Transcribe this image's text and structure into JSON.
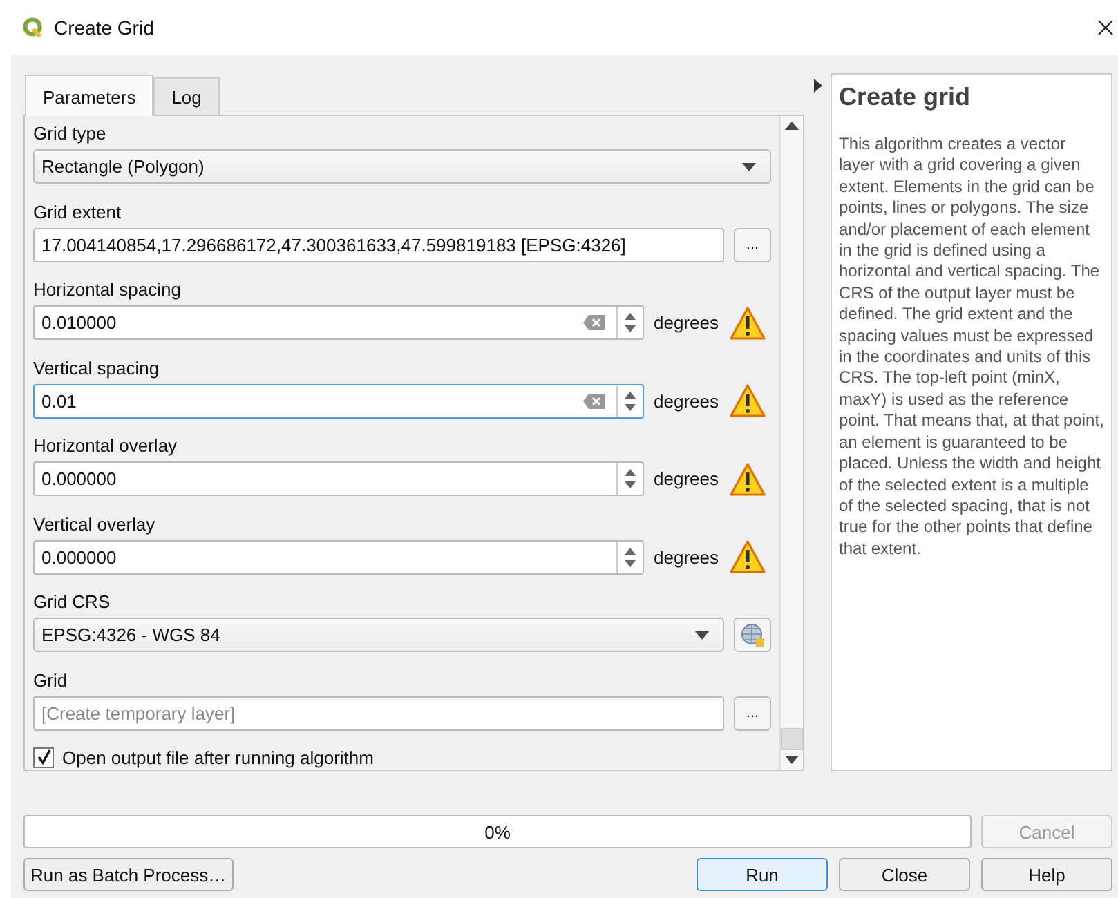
{
  "window": {
    "title": "Create Grid"
  },
  "tabs": [
    {
      "label": "Parameters",
      "selected": true
    },
    {
      "label": "Log",
      "selected": false
    }
  ],
  "parameters": [
    {
      "kind": "combo",
      "label": "Grid type",
      "value": "Rectangle (Polygon)"
    },
    {
      "kind": "extent",
      "label": "Grid extent",
      "value": "17.004140854,17.296686172,47.300361633,47.599819183 [EPSG:4326]",
      "button": "..."
    },
    {
      "kind": "spin",
      "label": "Horizontal spacing",
      "value": "0.010000",
      "clearable": true,
      "focused": false,
      "unit": "degrees",
      "warning": true
    },
    {
      "kind": "spin",
      "label": "Vertical spacing",
      "value": "0.01",
      "clearable": true,
      "focused": true,
      "unit": "degrees",
      "warning": true
    },
    {
      "kind": "spin",
      "label": "Horizontal overlay",
      "value": "0.000000",
      "clearable": false,
      "focused": false,
      "unit": "degrees",
      "warning": true
    },
    {
      "kind": "spin",
      "label": "Vertical overlay",
      "value": "0.000000",
      "clearable": false,
      "focused": false,
      "unit": "degrees",
      "warning": true
    },
    {
      "kind": "crs",
      "label": "Grid CRS",
      "value": "EPSG:4326 - WGS 84"
    },
    {
      "kind": "output",
      "label": "Grid",
      "placeholder": "[Create temporary layer]",
      "button": "..."
    },
    {
      "kind": "checkbox",
      "label": "Open output file after running algorithm",
      "checked": true
    }
  ],
  "help": {
    "title": "Create grid",
    "text": "This algorithm creates a vector layer with a grid covering a given extent. Elements in the grid can be points, lines or polygons. The size and/or placement of each element in the grid is defined using a horizontal and vertical spacing. The CRS of the output layer must be defined. The grid extent and the spacing values must be expressed in the coordinates and units of this CRS. The top-left point (minX, maxY) is used as the reference point. That means that, at that point, an element is guaranteed to be placed. Unless the width and height of the selected extent is a multiple of the selected spacing, that is not true for the other points that define that extent."
  },
  "progress": {
    "level": 0,
    "reading": "0%"
  },
  "buttons": [
    {
      "label": "Cancel",
      "disabled": true,
      "default": false
    },
    {
      "label": "Run as Batch Process…",
      "disabled": false,
      "default": false
    },
    {
      "label": "Run",
      "disabled": false,
      "default": true
    },
    {
      "label": "Close",
      "disabled": false,
      "default": false
    },
    {
      "label": "Help",
      "disabled": false,
      "default": false
    }
  ]
}
